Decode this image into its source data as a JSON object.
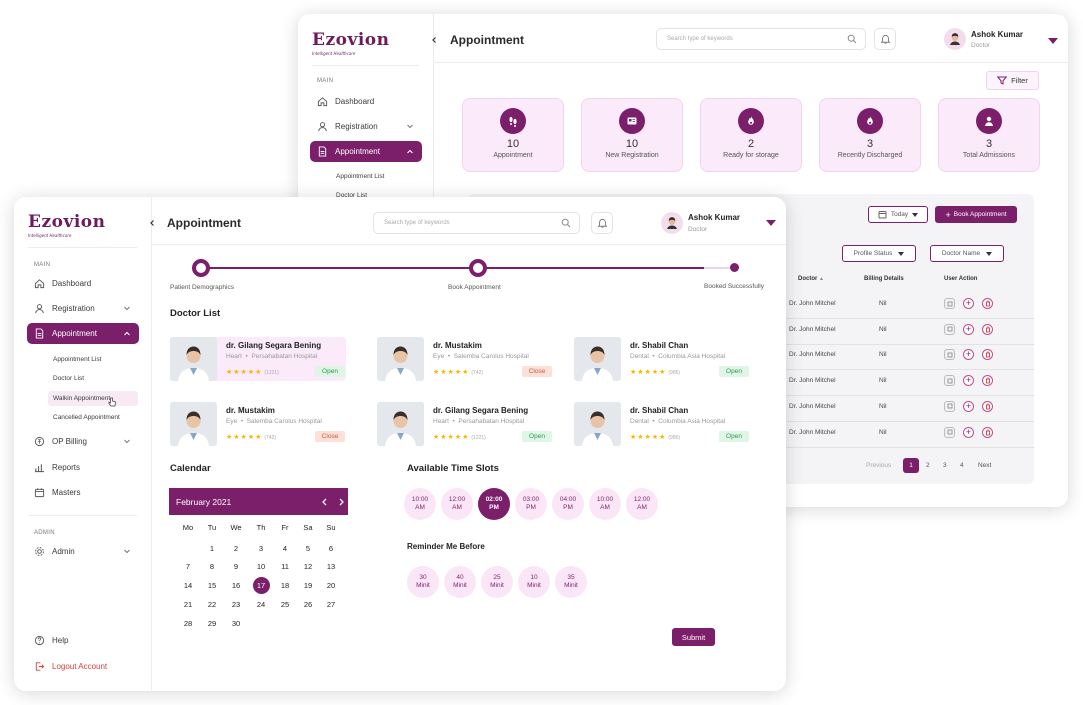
{
  "brand": {
    "name": "Ezovion",
    "tagline": "Intelligent Healthcare",
    "accent": "#7b1f6a"
  },
  "back": {
    "sidebar": {
      "section_main": "MAIN",
      "items": [
        {
          "label": "Dashboard",
          "icon": "home-icon"
        },
        {
          "label": "Registration",
          "icon": "user-icon"
        },
        {
          "label": "Appointment",
          "icon": "document-icon"
        }
      ],
      "sub": [
        "Appointment List",
        "Doctor List"
      ]
    },
    "header": {
      "title": "Appointment",
      "search_placeholder": "Search type of keywords",
      "user_name": "Ashok Kumar",
      "user_role": "Doctor"
    },
    "filter_label": "Filter",
    "stats": [
      {
        "value": "10",
        "label": "Appointment",
        "icon": "footprints-icon"
      },
      {
        "value": "10",
        "label": "New Registration",
        "icon": "id-card-icon"
      },
      {
        "value": "2",
        "label": "Ready for storage",
        "icon": "flame-icon"
      },
      {
        "value": "3",
        "label": "Recently Discharged",
        "icon": "flame-icon"
      },
      {
        "value": "3",
        "label": "Total Admissions",
        "icon": "person-icon"
      }
    ],
    "toolbar": {
      "today": "Today",
      "book": "Book Appointment",
      "profile_status": "Profile Status",
      "doctor_name": "Doctor Name"
    },
    "table": {
      "headers": [
        "Doctor",
        "Billing Details",
        "User Action"
      ],
      "rows": [
        {
          "doctor": "Dr. John Mitchel",
          "billing": "Nil"
        },
        {
          "doctor": "Dr. John Mitchel",
          "billing": "Nil"
        },
        {
          "doctor": "Dr. John Mitchel",
          "billing": "Nil"
        },
        {
          "doctor": "Dr. John Mitchel",
          "billing": "Nil"
        },
        {
          "doctor": "Dr. John Mitchel",
          "billing": "Nil"
        },
        {
          "doctor": "Dr. John Mitchel",
          "billing": "Nil"
        }
      ]
    },
    "pagination": {
      "previous": "Previous",
      "pages": [
        "1",
        "2",
        "3",
        "4"
      ],
      "current": "1",
      "next": "Next"
    }
  },
  "front": {
    "sidebar": {
      "section_main": "MAIN",
      "items": [
        {
          "label": "Dashboard",
          "icon": "home-icon"
        },
        {
          "label": "Registration",
          "icon": "user-icon"
        },
        {
          "label": "Appointment",
          "icon": "document-icon"
        },
        {
          "label": "OP Billing",
          "icon": "billing-icon"
        },
        {
          "label": "Reports",
          "icon": "bar-chart-icon"
        },
        {
          "label": "Masters",
          "icon": "calendar-icon"
        }
      ],
      "sub": [
        "Appointment List",
        "Doctor List",
        "Walkin Appointment",
        "Cancelled Appointment"
      ],
      "section_admin": "ADMIN",
      "admin": "Admin",
      "help": "Help",
      "logout": "Logout Account"
    },
    "header": {
      "title": "Appointment",
      "search_placeholder": "Search type of keywords",
      "user_name": "Ashok Kumar",
      "user_role": "Doctor"
    },
    "steps": [
      "Patient Demographics",
      "Book Appointment",
      "Booked Successfully"
    ],
    "doctor_list_title": "Doctor List",
    "doctors": [
      {
        "name": "dr. Gilang Segara Bening",
        "spec": "Heart",
        "hospital": "Persahabatan Hospital",
        "stars": "★★★★★",
        "count": "(1221)",
        "status": "Open",
        "selected": true
      },
      {
        "name": "dr. Mustakim",
        "spec": "Eye",
        "hospital": "Salemba Carolus Hospital",
        "stars": "★★★★★",
        "count": "(742)",
        "status": "Close"
      },
      {
        "name": "dr. Shabil Chan",
        "spec": "Dental",
        "hospital": "Columbia Asia Hospital",
        "stars": "★★★★★",
        "count": "(986)",
        "status": "Open"
      },
      {
        "name": "dr. Mustakim",
        "spec": "Eye",
        "hospital": "Salemba Carolus Hospital",
        "stars": "★★★★★",
        "count": "(742)",
        "status": "Close"
      },
      {
        "name": "dr. Gilang Segara Bening",
        "spec": "Heart",
        "hospital": "Persahabatan Hospital",
        "stars": "★★★★★",
        "count": "(1221)",
        "status": "Open"
      },
      {
        "name": "dr. Shabil Chan",
        "spec": "Dental",
        "hospital": "Columbia Asia Hospital",
        "stars": "★★★★★",
        "count": "(986)",
        "status": "Open"
      }
    ],
    "calendar": {
      "title": "Calendar",
      "month": "February 2021",
      "weekdays": [
        "Mo",
        "Tu",
        "We",
        "Th",
        "Fr",
        "Sa",
        "Su"
      ],
      "first_weekday_index": 1,
      "days": 30,
      "selected": 17
    },
    "slots_title": "Available Time Slots",
    "slots": [
      {
        "time": "10:00",
        "ampm": "AM"
      },
      {
        "time": "12:00",
        "ampm": "AM"
      },
      {
        "time": "02:00",
        "ampm": "PM",
        "selected": true
      },
      {
        "time": "03:00",
        "ampm": "PM"
      },
      {
        "time": "04:00",
        "ampm": "PM"
      },
      {
        "time": "10:00",
        "ampm": "AM"
      },
      {
        "time": "12:00",
        "ampm": "AM"
      }
    ],
    "reminder_title": "Reminder Me Before",
    "reminders": [
      {
        "value": "30",
        "unit": "Minit"
      },
      {
        "value": "40",
        "unit": "Minit"
      },
      {
        "value": "25",
        "unit": "Minit"
      },
      {
        "value": "10",
        "unit": "Minit"
      },
      {
        "value": "35",
        "unit": "Minit"
      }
    ],
    "submit": "Submit"
  }
}
